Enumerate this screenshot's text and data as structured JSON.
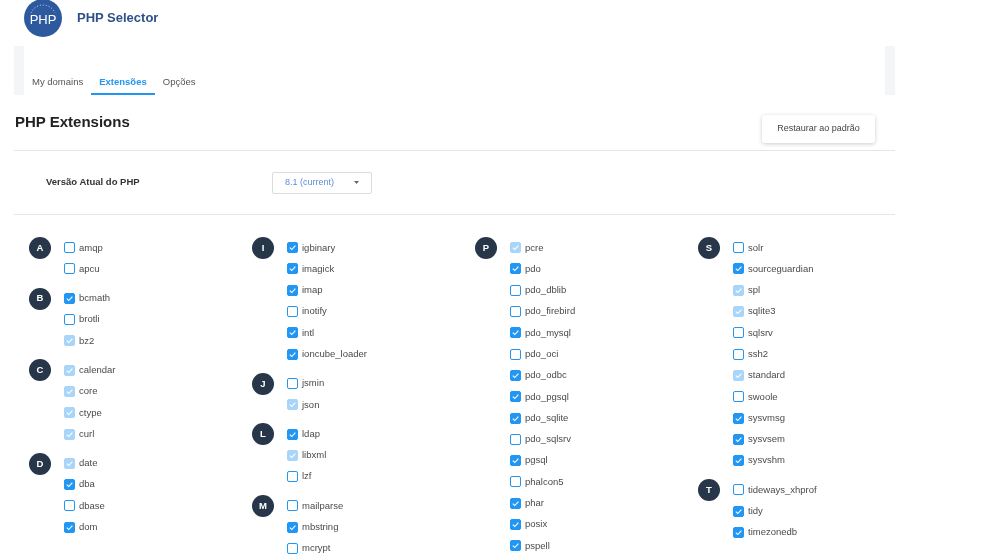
{
  "header": {
    "logo_text": "PHP",
    "title": "PHP Selector"
  },
  "tabs": [
    {
      "label": "My domains",
      "selected": false
    },
    {
      "label": "Extensões",
      "selected": true
    },
    {
      "label": "Opções",
      "selected": false
    }
  ],
  "section_title": "PHP Extensions",
  "restore_button": "Restaurar ao padrão",
  "version": {
    "label": "Versão Atual do PHP",
    "value": "8.1 (current)"
  },
  "columns": [
    {
      "groups": [
        {
          "letter": "A",
          "items": [
            {
              "name": "amqp",
              "checked": false,
              "disabled": false
            },
            {
              "name": "apcu",
              "checked": false,
              "disabled": false
            }
          ]
        },
        {
          "letter": "B",
          "items": [
            {
              "name": "bcmath",
              "checked": true,
              "disabled": false
            },
            {
              "name": "brotli",
              "checked": false,
              "disabled": false
            },
            {
              "name": "bz2",
              "checked": true,
              "disabled": true
            }
          ]
        },
        {
          "letter": "C",
          "items": [
            {
              "name": "calendar",
              "checked": true,
              "disabled": true
            },
            {
              "name": "core",
              "checked": true,
              "disabled": true
            },
            {
              "name": "ctype",
              "checked": true,
              "disabled": true
            },
            {
              "name": "curl",
              "checked": true,
              "disabled": true
            }
          ]
        },
        {
          "letter": "D",
          "items": [
            {
              "name": "date",
              "checked": true,
              "disabled": true
            },
            {
              "name": "dba",
              "checked": true,
              "disabled": false
            },
            {
              "name": "dbase",
              "checked": false,
              "disabled": false
            },
            {
              "name": "dom",
              "checked": true,
              "disabled": false
            }
          ]
        }
      ]
    },
    {
      "groups": [
        {
          "letter": "I",
          "items": [
            {
              "name": "igbinary",
              "checked": true,
              "disabled": false
            },
            {
              "name": "imagick",
              "checked": true,
              "disabled": false
            },
            {
              "name": "imap",
              "checked": true,
              "disabled": false
            },
            {
              "name": "inotify",
              "checked": false,
              "disabled": false
            },
            {
              "name": "intl",
              "checked": true,
              "disabled": false
            },
            {
              "name": "ioncube_loader",
              "checked": true,
              "disabled": false
            }
          ]
        },
        {
          "letter": "J",
          "items": [
            {
              "name": "jsmin",
              "checked": false,
              "disabled": false
            },
            {
              "name": "json",
              "checked": true,
              "disabled": true
            }
          ]
        },
        {
          "letter": "L",
          "items": [
            {
              "name": "ldap",
              "checked": true,
              "disabled": false
            },
            {
              "name": "libxml",
              "checked": true,
              "disabled": true
            },
            {
              "name": "lzf",
              "checked": false,
              "disabled": false
            }
          ]
        },
        {
          "letter": "M",
          "items": [
            {
              "name": "mailparse",
              "checked": false,
              "disabled": false
            },
            {
              "name": "mbstring",
              "checked": true,
              "disabled": false
            },
            {
              "name": "mcrypt",
              "checked": false,
              "disabled": false
            }
          ]
        }
      ]
    },
    {
      "groups": [
        {
          "letter": "P",
          "items": [
            {
              "name": "pcre",
              "checked": true,
              "disabled": true
            },
            {
              "name": "pdo",
              "checked": true,
              "disabled": false
            },
            {
              "name": "pdo_dblib",
              "checked": false,
              "disabled": false
            },
            {
              "name": "pdo_firebird",
              "checked": false,
              "disabled": false
            },
            {
              "name": "pdo_mysql",
              "checked": true,
              "disabled": false
            },
            {
              "name": "pdo_oci",
              "checked": false,
              "disabled": false
            },
            {
              "name": "pdo_odbc",
              "checked": true,
              "disabled": false
            },
            {
              "name": "pdo_pgsql",
              "checked": true,
              "disabled": false
            },
            {
              "name": "pdo_sqlite",
              "checked": true,
              "disabled": false
            },
            {
              "name": "pdo_sqlsrv",
              "checked": false,
              "disabled": false
            },
            {
              "name": "pgsql",
              "checked": true,
              "disabled": false
            },
            {
              "name": "phalcon5",
              "checked": false,
              "disabled": false
            },
            {
              "name": "phar",
              "checked": true,
              "disabled": false
            },
            {
              "name": "posix",
              "checked": true,
              "disabled": false
            },
            {
              "name": "pspell",
              "checked": true,
              "disabled": false
            }
          ]
        }
      ]
    },
    {
      "groups": [
        {
          "letter": "S",
          "items": [
            {
              "name": "solr",
              "checked": false,
              "disabled": false
            },
            {
              "name": "sourceguardian",
              "checked": true,
              "disabled": false
            },
            {
              "name": "spl",
              "checked": true,
              "disabled": true
            },
            {
              "name": "sqlite3",
              "checked": true,
              "disabled": true
            },
            {
              "name": "sqlsrv",
              "checked": false,
              "disabled": false
            },
            {
              "name": "ssh2",
              "checked": false,
              "disabled": false
            },
            {
              "name": "standard",
              "checked": true,
              "disabled": true
            },
            {
              "name": "swoole",
              "checked": false,
              "disabled": false
            },
            {
              "name": "sysvmsg",
              "checked": true,
              "disabled": false
            },
            {
              "name": "sysvsem",
              "checked": true,
              "disabled": false
            },
            {
              "name": "sysvshm",
              "checked": true,
              "disabled": false
            }
          ]
        },
        {
          "letter": "T",
          "items": [
            {
              "name": "tideways_xhprof",
              "checked": false,
              "disabled": false
            },
            {
              "name": "tidy",
              "checked": true,
              "disabled": false
            },
            {
              "name": "timezonedb",
              "checked": true,
              "disabled": false
            }
          ]
        }
      ]
    }
  ]
}
